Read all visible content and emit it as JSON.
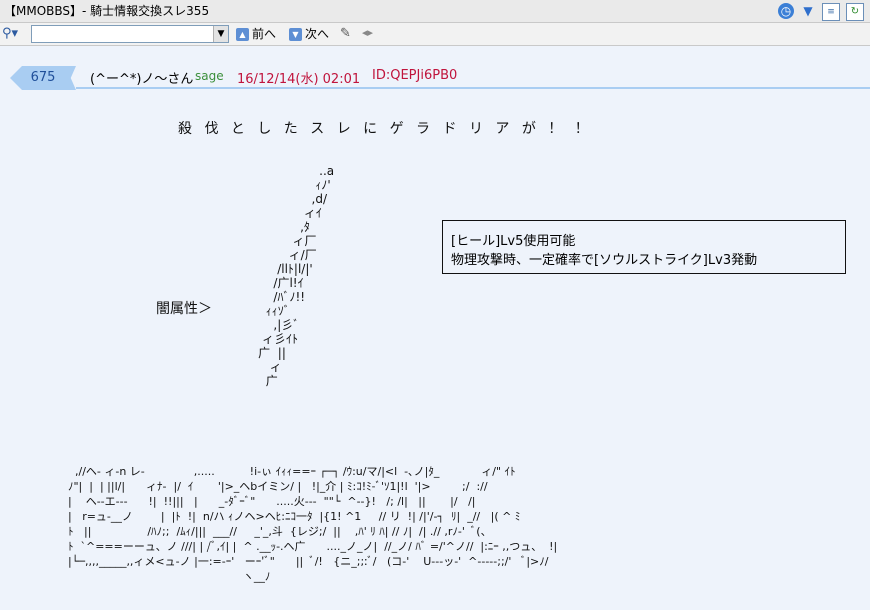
{
  "window": {
    "title": "【MMOBBS】- 騎士情報交換スレ355"
  },
  "toolbar": {
    "search_placeholder": "",
    "prev_label": "前へ",
    "next_label": "次へ"
  },
  "icons": {
    "clock": "clock-icon",
    "filter": "funnel-icon",
    "document": "document-icon",
    "refresh": "refresh-icon",
    "search": "search-icon",
    "edit": "pen-icon"
  },
  "post": {
    "number": "675",
    "name": "(^ー^*)ノ〜さん",
    "mail": "sage",
    "date": "16/12/14(水) 02:01",
    "id": "ID:QEPJi6PB0"
  },
  "body": {
    "headline": "殺 伐 と し た ス レ に ゲ ラ ド リ ア が ！ ！",
    "element_label": "闇属性＞",
    "info_lines": [
      "[ヒール]Lv5使用可能",
      "物理攻撃時、一定確率で[ソウルストライク]Lv3発動"
    ],
    "sword_art": "                          ..a\n                         ｨﾉ'\n                        ,d/\n                      ィｲ\n                     ,ﾀ\n                   ィ厂\n                  ィ/厂\n               /llﾄ|l/|'\n              /广l!ｲ\n              /ﾊﾞﾉ!!\n            ｨｨｿﾞ\n              ,|彡ﾞ\n           ィ彡ｲﾄ\n          广  ||\n             ィ\n            广",
    "bottom_art": "  ,//ヘ- ィ-n レ-              ,.....          !i-ぃ ｲｨｨ==ｰ ┌─┐ /ｳ:u/マ/|<l  -､ノ|ﾀ_            ィ/\" ｲﾄ\nﾉ\"|  |  | ||l/|      ィﾅ-  |/  ｲ       '|>_ヘbイミン/ |   !|_介 | ﾐ:ｺ!ﾐ-ﾞ'ｿ1|!l  '|>         ;/  ://\n|    ヘ--エ---      !|  !!|||   |      _-ﾀﾞｰﾞ\"      .....火---  \"\"└  ^--}!   /; /l|   ||       |/   /|\n|   r=ュ-__ノ        |  |ﾄ  !|  n/ハ ｨノヘ>ヘﾋ:ﾆｺ一ﾀ  |{1! ^1     // リ  !| /|'/-┐  ﾘ|  _//   |( ^ ﾐ\nﾄ   ||                /ﾊﾉ;;  /ﾑｨ/|||  ___//     _'_,斗  {レジ;/  ||    ,ﾊ' ﾘ ﾊ| // ﾉ|  /| .// ,rﾉ-'  ﾞ(、\nﾄ  `^===ーーュ、ノ ///| | /ﾞ,ｲ| |  ^ .__ｯ-.ヘ广      ...._ノ_ノ|  //_ノ/ ﾊﾞ =/'^ノ//  |:ﾆｰ ,,つュ、  !|\n|└─,,,,_____,,ィメ<ュ-ノ |一:=-ｰ'   ーｰ'ﾞ\"      ||  ﾞ/!   {ニ_;;:ﾞ/   (コ-'    U---ッ-'  ^-----;;/'   ﾞ|>ﾉ/\n                                                  ヽ__ﾉ"
  }
}
